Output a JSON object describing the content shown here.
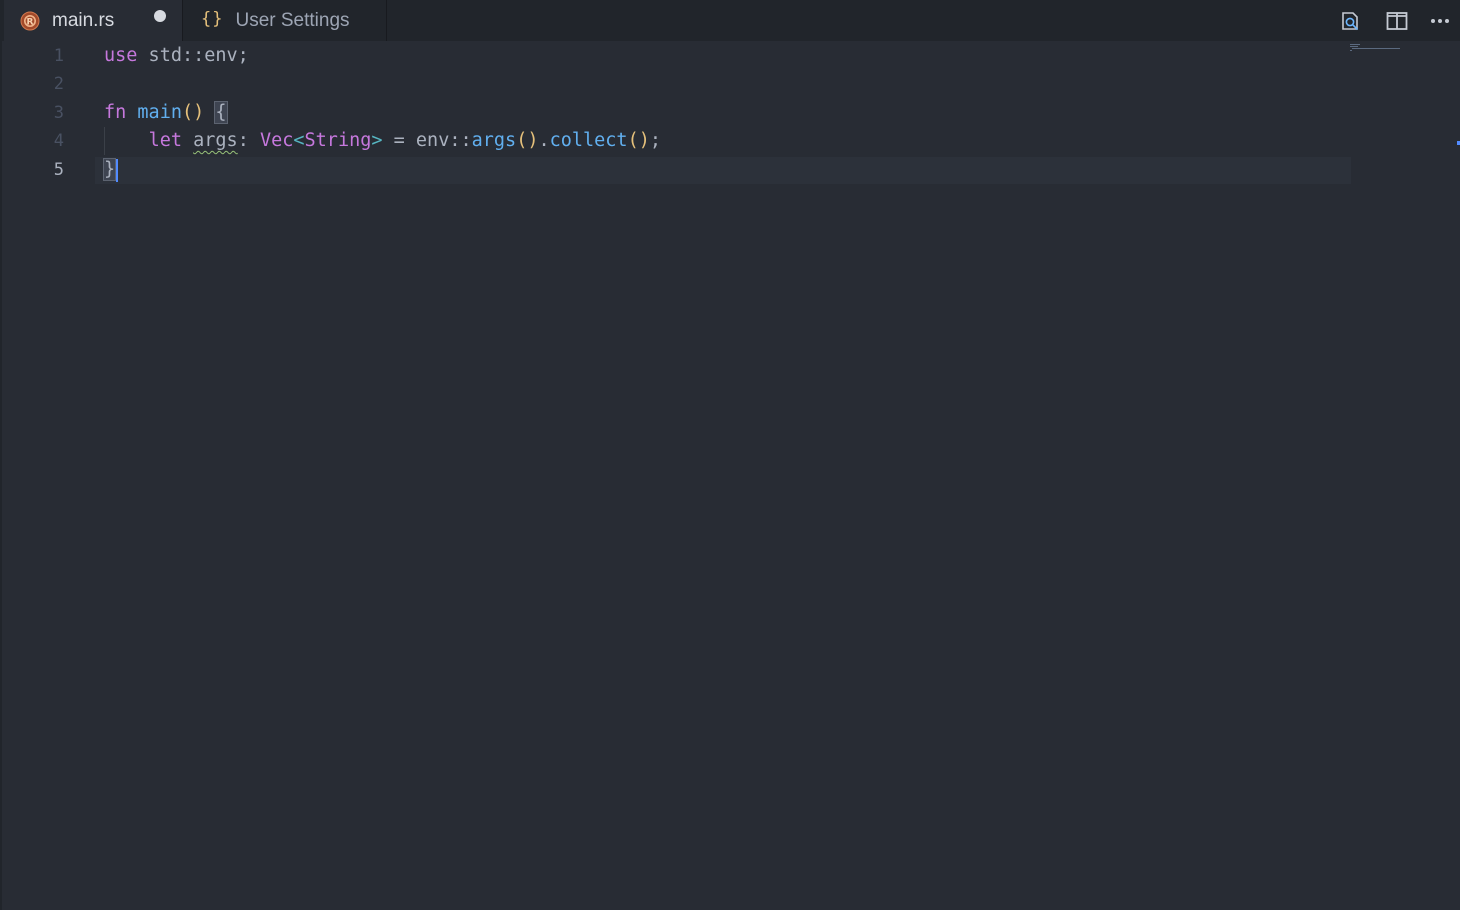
{
  "tabs": [
    {
      "label": "main.rs",
      "icon": "rust-icon",
      "active": true,
      "dirty": true
    },
    {
      "label": "User Settings",
      "icon": "json-braces-icon",
      "icon_glyph": "{}",
      "active": false
    }
  ],
  "toolbar": {
    "actions": [
      "open-preview-icon",
      "split-editor-icon",
      "more-actions-icon"
    ]
  },
  "editor": {
    "language": "rust",
    "current_line": 5,
    "line_numbers": [
      "1",
      "2",
      "3",
      "4",
      "5"
    ],
    "lines": [
      "use std::env;",
      "",
      "fn main() {",
      "    let args: Vec<String> = env::args().collect();",
      "}"
    ],
    "tokens": {
      "l1_use": "use",
      "l1_rest": " std::env;",
      "l3_fn": "fn",
      "l3_main": "main",
      "l3_parens": "()",
      "l3_space": " ",
      "l3_brace": "{",
      "l4_indent": "    ",
      "l4_let": "let",
      "l4_sp": " ",
      "l4_args": "args",
      "l4_colon": ": ",
      "l4_vec": "Vec",
      "l4_lt": "<",
      "l4_string": "String",
      "l4_gt": ">",
      "l4_eq": " = ",
      "l4_env": "env",
      "l4_sep": "::",
      "l4_argsfn": "args",
      "l4_p1": "()",
      "l4_dot": ".",
      "l4_collect": "collect",
      "l4_p2": "()",
      "l4_semi": ";",
      "l5_brace": "}"
    }
  },
  "colors": {
    "background": "#282c34",
    "tabbar": "#21252b",
    "keyword": "#c678dd",
    "function": "#61afef",
    "bracket": "#e5c07b",
    "text": "#abb2bf",
    "line_number": "#495162",
    "cursor": "#528bff",
    "squiggle": "#98c379"
  }
}
